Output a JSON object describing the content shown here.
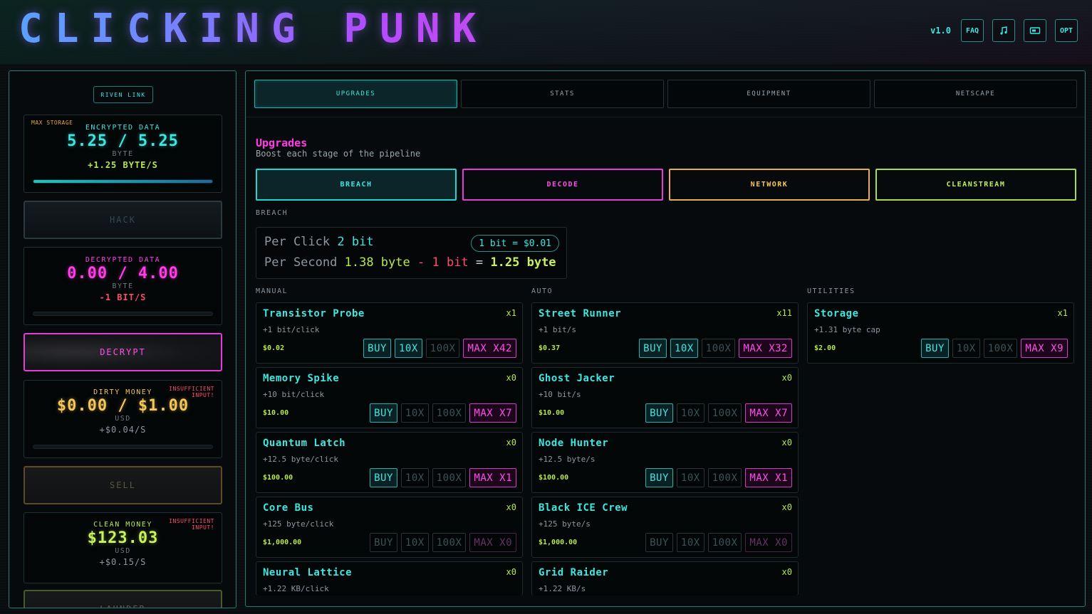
{
  "header": {
    "title": "CLICKING PUNK",
    "version": "v1.0",
    "buttons": {
      "faq": "FAQ",
      "music_icon": "music-note-icon",
      "display_icon": "display-icon",
      "opt": "OPT"
    }
  },
  "left": {
    "riven_link": "RIVEN LINK",
    "encrypted": {
      "tag": "MAX STORAGE",
      "title": "ENCRYPTED DATA",
      "current": "5.25",
      "sep": "/",
      "max": "5.25",
      "unit": "BYTE",
      "rate": "+1.25 BYTE/S",
      "fill": 1.0
    },
    "hack_label": "HACK",
    "decrypted": {
      "title": "DECRYPTED DATA",
      "current": "0.00",
      "sep": "/",
      "max": "4.00",
      "unit": "BYTE",
      "rate": "-1 BIT/S",
      "fill": 0.0
    },
    "decrypt_label": "DECRYPT",
    "dirty": {
      "title": "DIRTY MONEY",
      "warn": "INSUFFICIENT INPUT!",
      "current": "$0.00",
      "sep": "/",
      "max": "$1.00",
      "unit": "USD",
      "rate": "+$0.04/S",
      "fill": 0.0
    },
    "sell_label": "SELL",
    "clean": {
      "title": "CLEAN MONEY",
      "warn": "INSUFFICIENT INPUT!",
      "value": "$123.03",
      "unit": "USD",
      "rate": "+$0.15/S"
    },
    "launder_label": "LAUNDER"
  },
  "tabs": [
    "UPGRADES",
    "STATS",
    "EQUIPMENT",
    "NETSCAPE"
  ],
  "upgrades": {
    "title": "Upgrades",
    "subtitle": "Boost each stage of the pipeline",
    "stages": [
      "BREACH",
      "DECODE",
      "NETWORK",
      "CLEANSTREAM"
    ],
    "stage_colors": [
      "#1fd6d0",
      "#ff3de6",
      "#f0b840",
      "#b6e84a"
    ],
    "breach_label": "BREACH",
    "per_click_label": "Per Click",
    "per_click_value": "2 bit",
    "rate_pill": "1 bit = $0.01",
    "per_second_label": "Per Second",
    "per_second_a": "1.38 byte",
    "per_second_minus": "-",
    "per_second_b": "1 bit",
    "per_second_eq": "=",
    "per_second_result": "1.25 byte",
    "col_labels": [
      "MANUAL",
      "AUTO",
      "UTILITIES"
    ]
  },
  "buttons_text": {
    "buy": "BUY",
    "x10": "10X",
    "x100": "100X"
  },
  "manual": [
    {
      "name": "Transistor Probe",
      "count": "x1",
      "desc": "+1 bit/click",
      "price": "$0.02",
      "max": "MAX X42",
      "state": "active"
    },
    {
      "name": "Memory Spike",
      "count": "x0",
      "desc": "+10 bit/click",
      "price": "$10.00",
      "max": "MAX X7",
      "state": "buyonly"
    },
    {
      "name": "Quantum Latch",
      "count": "x0",
      "desc": "+12.5 byte/click",
      "price": "$100.00",
      "max": "MAX X1",
      "state": "buyonly"
    },
    {
      "name": "Core Bus",
      "count": "x0",
      "desc": "+125 byte/click",
      "price": "$1,000.00",
      "max": "MAX X0",
      "state": "disabled"
    },
    {
      "name": "Neural Lattice",
      "count": "x0",
      "desc": "+1.22 KB/click",
      "price": "",
      "max": "",
      "state": "partial"
    }
  ],
  "auto": [
    {
      "name": "Street Runner",
      "count": "x11",
      "desc": "+1 bit/s",
      "price": "$0.37",
      "max": "MAX X32",
      "state": "active"
    },
    {
      "name": "Ghost Jacker",
      "count": "x0",
      "desc": "+10 bit/s",
      "price": "$10.00",
      "max": "MAX X7",
      "state": "buyonly"
    },
    {
      "name": "Node Hunter",
      "count": "x0",
      "desc": "+12.5 byte/s",
      "price": "$100.00",
      "max": "MAX X1",
      "state": "buyonly"
    },
    {
      "name": "Black ICE Crew",
      "count": "x0",
      "desc": "+125 byte/s",
      "price": "$1,000.00",
      "max": "MAX X0",
      "state": "disabled"
    },
    {
      "name": "Grid Raider",
      "count": "x0",
      "desc": "+1.22 KB/s",
      "price": "",
      "max": "",
      "state": "partial"
    }
  ],
  "utilities": [
    {
      "name": "Storage",
      "count": "x1",
      "desc": "+1.31 byte cap",
      "price": "$2.00",
      "max": "MAX X9",
      "state": "buyonly"
    }
  ]
}
